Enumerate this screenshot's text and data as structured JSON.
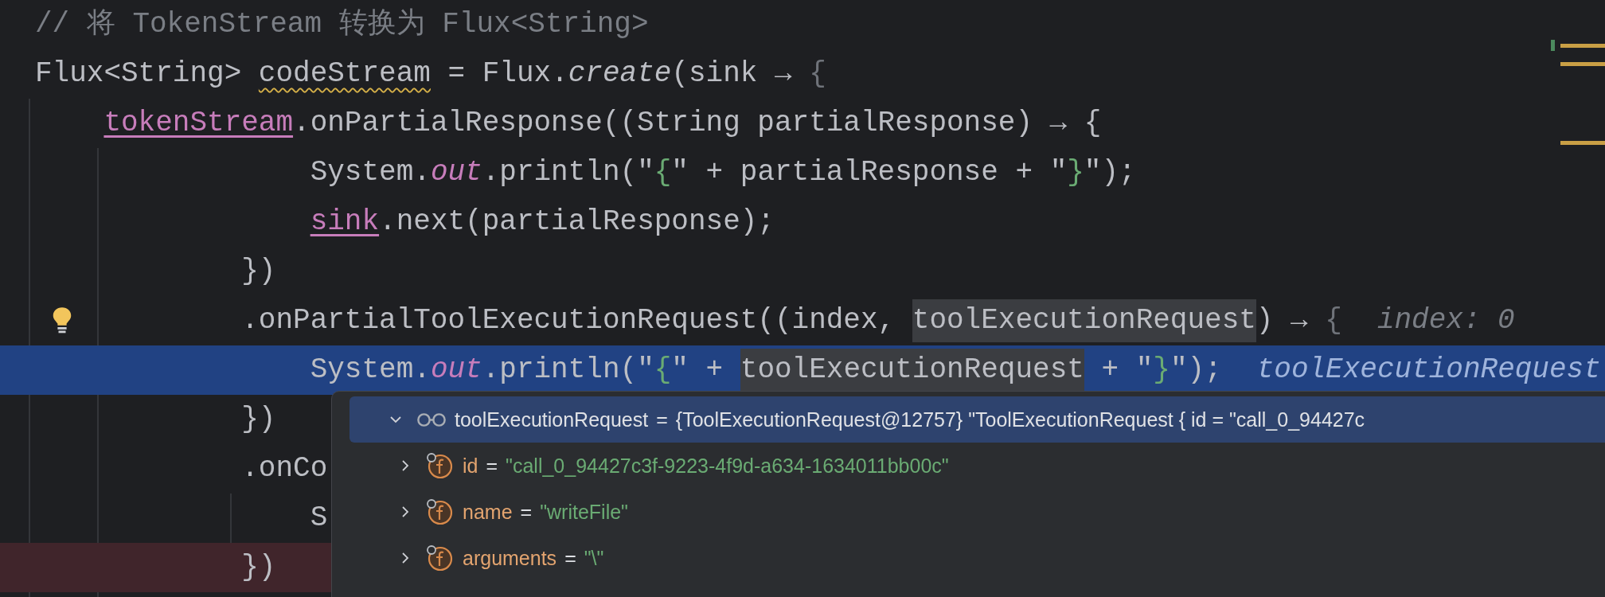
{
  "editor": {
    "lines": [
      {
        "kind": "top",
        "tokens": [
          {
            "text": "// 将 TokenStream 转换为 Flux<String>",
            "kind": "comment"
          }
        ],
        "bulb": false,
        "execution": false,
        "breakpoint": false
      },
      {
        "kind": "top",
        "tokens": [
          {
            "text": "Flux<String> ",
            "kind": "plain"
          },
          {
            "text": "codeStream",
            "kind": "warning"
          },
          {
            "text": " = Flux.",
            "kind": "plain"
          },
          {
            "text": "create",
            "kind": "italic"
          },
          {
            "text": "(sink → ",
            "kind": "plain"
          },
          {
            "text": "{",
            "kind": "muted"
          }
        ],
        "bulb": false,
        "execution": false,
        "breakpoint": false
      },
      {
        "kind": "block",
        "tokens": [
          {
            "text": "tokenStream",
            "kind": "field"
          },
          {
            "text": ".onPartialResponse((String partialResponse) → {",
            "kind": "plain"
          }
        ],
        "bulb": false,
        "execution": false,
        "breakpoint": false
      },
      {
        "kind": "body",
        "tokens": [
          {
            "text": "System.",
            "kind": "plain"
          },
          {
            "text": "out",
            "kind": "static"
          },
          {
            "text": ".println(\"",
            "kind": "plain"
          },
          {
            "text": "{",
            "kind": "string"
          },
          {
            "text": "\" + partialResponse + \"",
            "kind": "plain"
          },
          {
            "text": "}",
            "kind": "string"
          },
          {
            "text": "\");",
            "kind": "plain"
          }
        ],
        "bulb": false,
        "execution": false,
        "breakpoint": false
      },
      {
        "kind": "body",
        "tokens": [
          {
            "text": "sink",
            "kind": "field"
          },
          {
            "text": ".next(partialResponse);",
            "kind": "plain"
          }
        ],
        "bulb": false,
        "execution": false,
        "breakpoint": false
      },
      {
        "kind": "chain",
        "tokens": [
          {
            "text": "})",
            "kind": "plain"
          }
        ],
        "bulb": false,
        "execution": false,
        "breakpoint": false
      },
      {
        "kind": "chain",
        "tokens": [
          {
            "text": ".onPartialToolExecutionRequest((index, ",
            "kind": "plain"
          },
          {
            "text": "toolExecutionRequest",
            "kind": "selected"
          },
          {
            "text": ") → ",
            "kind": "plain"
          },
          {
            "text": "{",
            "kind": "muted"
          }
        ],
        "hint": "index: 0",
        "bulb": true,
        "execution": false,
        "breakpoint": false
      },
      {
        "kind": "body",
        "tokens": [
          {
            "text": "System.",
            "kind": "plain"
          },
          {
            "text": "out",
            "kind": "static"
          },
          {
            "text": ".println(\"",
            "kind": "plain"
          },
          {
            "text": "{",
            "kind": "string"
          },
          {
            "text": "\" + ",
            "kind": "plain"
          },
          {
            "text": "toolExecutionRequest",
            "kind": "selected"
          },
          {
            "text": " + \"",
            "kind": "plain"
          },
          {
            "text": "}",
            "kind": "string"
          },
          {
            "text": "\");",
            "kind": "plain"
          }
        ],
        "hint": "toolExecutionRequest",
        "bulb": false,
        "execution": true,
        "breakpoint": false
      },
      {
        "kind": "chain",
        "tokens": [
          {
            "text": "})",
            "kind": "plain"
          }
        ],
        "bulb": false,
        "execution": false,
        "breakpoint": false
      },
      {
        "kind": "chain",
        "tokens": [
          {
            "text": ".onCo",
            "kind": "plain"
          }
        ],
        "bulb": false,
        "execution": false,
        "breakpoint": false
      },
      {
        "kind": "body",
        "tokens": [
          {
            "text": "S",
            "kind": "plain"
          }
        ],
        "bulb": false,
        "execution": false,
        "breakpoint": false
      },
      {
        "kind": "chain",
        "tokens": [
          {
            "text": "})",
            "kind": "plain"
          }
        ],
        "bulb": false,
        "execution": false,
        "breakpoint": true
      }
    ]
  },
  "debug_popup": {
    "nodes": [
      {
        "kind": "watch",
        "name": "toolExecutionRequest",
        "operator": "=",
        "value": "{ToolExecutionRequest@12757} \"ToolExecutionRequest { id = \"call_0_94427c",
        "expanded": true,
        "selected": true
      },
      {
        "kind": "field",
        "name": "id",
        "operator": "=",
        "value": "\"call_0_94427c3f-9223-4f9d-a634-1634011bb00c\"",
        "expanded": false,
        "selected": false
      },
      {
        "kind": "field",
        "name": "name",
        "operator": "=",
        "value": "\"writeFile\"",
        "expanded": false,
        "selected": false
      },
      {
        "kind": "field",
        "name": "arguments",
        "operator": "=",
        "value": "\"\\\"",
        "expanded": false,
        "selected": false
      }
    ]
  }
}
